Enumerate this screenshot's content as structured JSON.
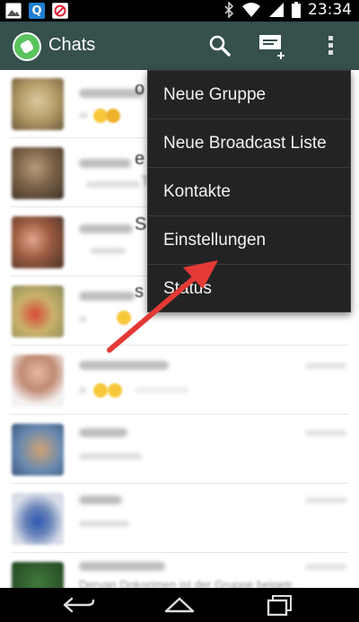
{
  "status_bar": {
    "time": "23:34",
    "icons": [
      "image-notification-icon",
      "q-app-icon",
      "no-entry-app-icon",
      "bluetooth-icon",
      "wifi-icon",
      "signal-icon",
      "battery-icon"
    ],
    "q_letter": "Q"
  },
  "app_bar": {
    "title": "Chats",
    "icons": [
      "whatsapp-logo-icon",
      "search-icon",
      "new-chat-icon",
      "overflow-menu-icon"
    ],
    "colors": {
      "background": "#35504d",
      "logo": "#5ac45e"
    }
  },
  "chat_list": {
    "fragments": {
      "row1_title_end": "o",
      "row2_title_end": "e",
      "row2_sub_end": "T",
      "row3_title_end": "S",
      "row4_title_end": "s"
    },
    "last_row_preview": "Dervan Dokorimen ist der Gruppe beigetr..."
  },
  "menu": {
    "items": [
      "Neue Gruppe",
      "Neue Broadcast Liste",
      "Kontakte",
      "Einstellungen",
      "Status"
    ],
    "colors": {
      "background": "#232323",
      "text": "#f2f2f2"
    }
  },
  "annotation": {
    "arrow_color": "#e53935"
  },
  "nav_bar": {
    "icons": [
      "back-icon",
      "home-icon",
      "recent-apps-icon"
    ]
  }
}
